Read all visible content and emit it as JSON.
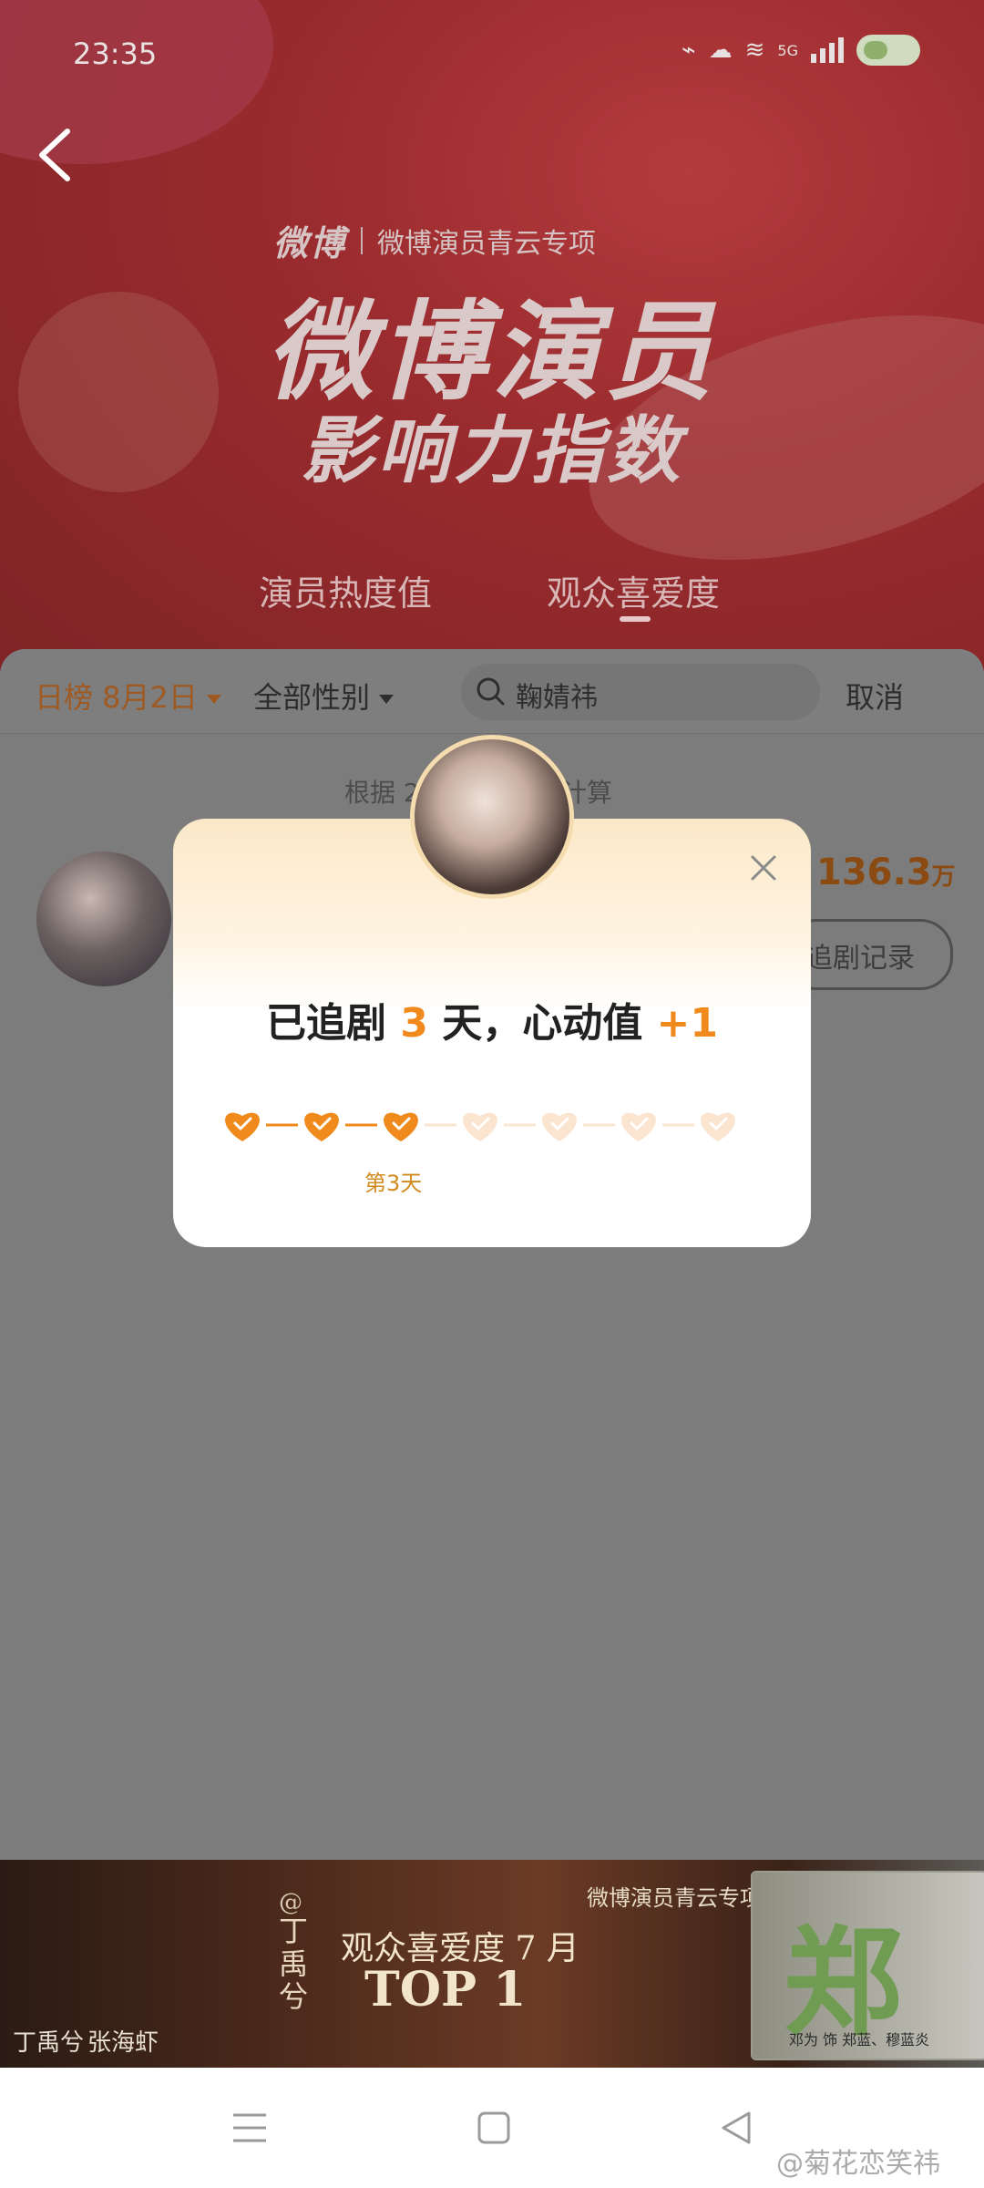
{
  "status_bar": {
    "time": "23:35",
    "network": "5G"
  },
  "header": {
    "brand": "微博",
    "brand_sub": "微博演员青云专项",
    "title_line1": "微博演员",
    "title_line2": "影响力指数",
    "tabs": [
      {
        "label": "演员热度值",
        "active": false
      },
      {
        "label": "观众喜爱度",
        "active": true
      }
    ]
  },
  "filters": {
    "date_label": "日榜 8月2日",
    "gender_label": "全部性别",
    "search_value": "鞠婧祎",
    "cancel_label": "取消"
  },
  "list": {
    "basis_left": "根据 2",
    "basis_right": "计算",
    "score": "136.3",
    "score_unit": "万",
    "record_button": "追剧记录"
  },
  "modal": {
    "title_prefix": "已追剧 ",
    "days": "3",
    "title_mid": " 天，心动值 ",
    "points": "+1",
    "current_day_label": "第3天",
    "total_days": 7,
    "completed_days": 3
  },
  "banner": {
    "special": "微博演员青云专项",
    "at": "@",
    "name_vertical": "丁禹兮",
    "love_month": "观众喜爱度 7 月",
    "top": "TOP 1",
    "left_names": [
      "丁禹兮",
      "张海虾"
    ],
    "right_char": "郑",
    "right_credit": "邓为 饰 郑蓝、穆蓝炎"
  },
  "watermark": "@菊花恋笑祎",
  "colors": {
    "accent": "#f08a1c",
    "heart_inactive": "#fbe5d0"
  }
}
